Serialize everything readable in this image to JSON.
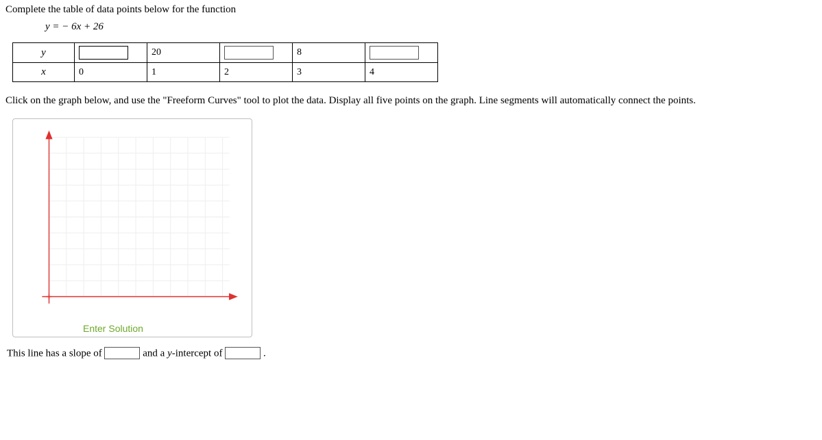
{
  "question": {
    "line1": "Complete the table of data points below for the function",
    "equation": "y = − 6x + 26",
    "instruction": "Click on the graph below, and use the \"Freeform Curves\" tool to plot the data. Display all five points on the graph. Line segments will automatically connect the points.",
    "final_pre": "This line has a slope of",
    "final_mid": "and a ",
    "final_var": "y",
    "final_post": "-intercept of",
    "period": "."
  },
  "table": {
    "row_y_label": "y",
    "row_x_label": "x",
    "y_values": {
      "c1_static": "20",
      "c3_static": "8"
    },
    "x_values": {
      "c0": "0",
      "c1": "1",
      "c2": "2",
      "c3": "3",
      "c4": "4"
    }
  },
  "graph": {
    "enter_solution_label": "Enter Solution"
  },
  "inputs": {
    "slope": "",
    "intercept": "",
    "y0": "",
    "y2": "",
    "y4": ""
  },
  "chart_data": {
    "type": "line",
    "title": "",
    "xlabel": "",
    "ylabel": "",
    "x": [
      0,
      1,
      2,
      3,
      4
    ],
    "y": [
      null,
      20,
      null,
      8,
      null
    ],
    "xlim": [
      0,
      5
    ],
    "ylim": [
      0,
      30
    ],
    "grid": true,
    "notes": "Empty coordinate plane awaiting plotted points for y = -6x + 26"
  }
}
